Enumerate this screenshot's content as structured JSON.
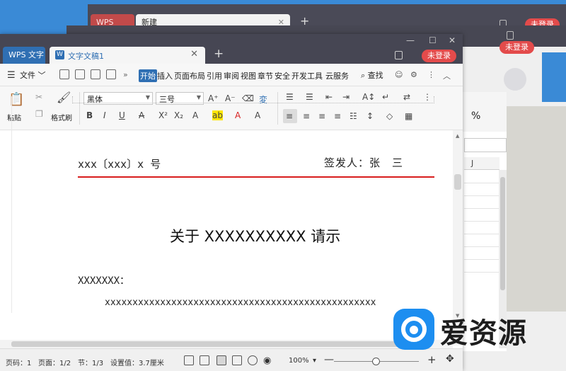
{
  "back_window_1": {
    "tabs": [
      "WPS PDF",
      "新建"
    ],
    "login_label": "未登录"
  },
  "back_window_2": {
    "login_label": "未登录",
    "sheet_column": "J"
  },
  "window": {
    "app_tab": "WPS 文字",
    "doc_tab_icon": "W",
    "doc_tab_title": "文字文稿1",
    "login_label": "未登录"
  },
  "menu": {
    "file_label": "文件",
    "tabs": [
      "开始",
      "插入",
      "页面布局",
      "引用",
      "审阅",
      "视图",
      "章节",
      "安全",
      "开发工具",
      "云服务"
    ],
    "active_tab": "开始",
    "find_label": "查找"
  },
  "ribbon": {
    "paste_label": "粘贴",
    "format_painter_label": "格式刷",
    "font_name": "黑体",
    "font_size": "三号",
    "bold": "B",
    "italic": "I",
    "underline": "U",
    "number_format": "%"
  },
  "document": {
    "doc_number": "xxx〔xxx〕x 号",
    "issuer": "签发人：张　三",
    "title": "关于 XXXXXXXXXX 请示",
    "addressee": "XXXXXXX：",
    "body_line": "xxxxxxxxxxxxxxxxxxxxxxxxxxxxxxxxxxxxxxxxxxxxxxxxx"
  },
  "status": {
    "page_no": "页码：1",
    "pages": "页面：1/2",
    "section": "节：1/3",
    "setting_value": "设置值：3.7厘米",
    "zoom": "100%",
    "zoom_fraction": 0.5
  },
  "watermark": {
    "text": "爱资源"
  },
  "colors": {
    "accent": "#2f6fb3",
    "titlebar": "#464653",
    "login_pill": "#e34b4b",
    "header_rule": "#d81e1e",
    "watermark_blue": "#1d8ef0"
  }
}
